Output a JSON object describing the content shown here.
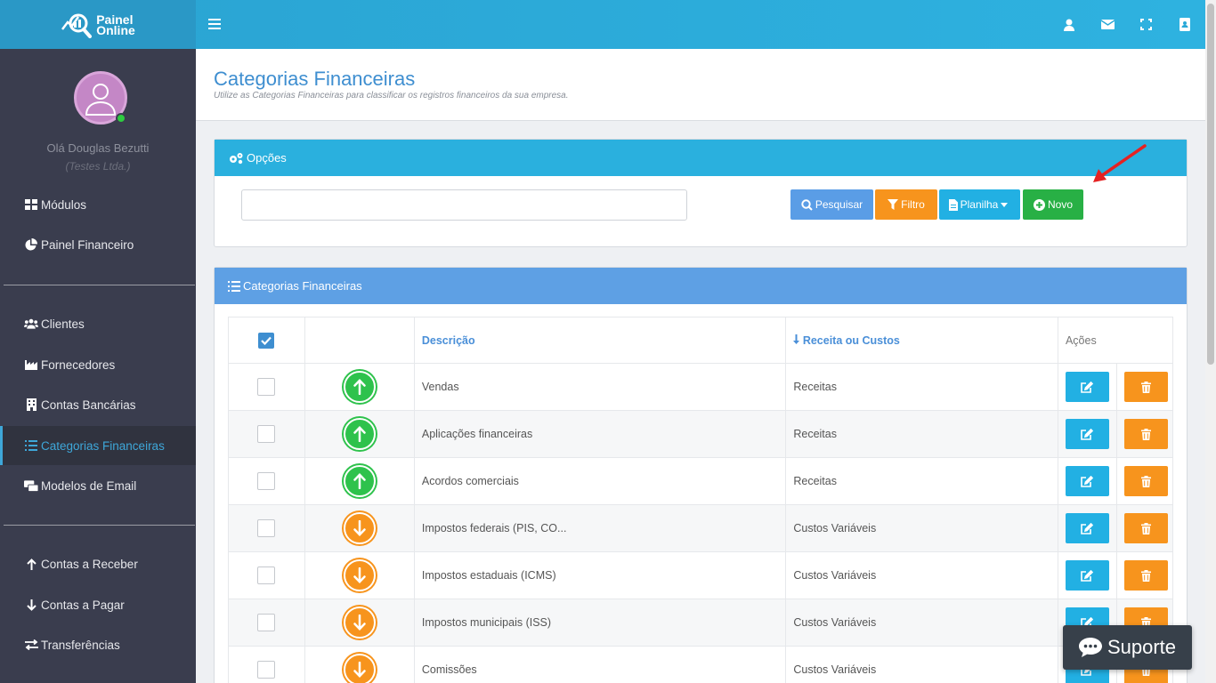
{
  "app": {
    "logo_line1": "Painel",
    "logo_line2": "Online"
  },
  "user": {
    "greeting": "Olá Douglas Bezutti",
    "company": "(Testes Ltda.)"
  },
  "sidebar": {
    "items": [
      {
        "label": "Módulos",
        "icon": "grid-icon"
      },
      {
        "label": "Painel Financeiro",
        "icon": "pie-chart-icon"
      },
      {
        "label": "Clientes",
        "icon": "users-icon"
      },
      {
        "label": "Fornecedores",
        "icon": "factory-icon"
      },
      {
        "label": "Contas Bancárias",
        "icon": "building-icon"
      },
      {
        "label": "Categorias Financeiras",
        "icon": "list-icon",
        "active": true
      },
      {
        "label": "Modelos de Email",
        "icon": "email-stack-icon"
      },
      {
        "label": "Contas a Receber",
        "icon": "arrow-up-icon"
      },
      {
        "label": "Contas a Pagar",
        "icon": "arrow-down-icon"
      },
      {
        "label": "Transferências",
        "icon": "exchange-icon"
      }
    ]
  },
  "page": {
    "title": "Categorias Financeiras",
    "subtitle": "Utilize as Categorias Financeiras para classificar os registros financeiros da sua empresa."
  },
  "options_panel": {
    "title": "Opções",
    "search_value": "",
    "search_label": "Pesquisar",
    "filter_label": "Filtro",
    "sheet_label": "Planilha",
    "new_label": "Novo"
  },
  "table_panel": {
    "title": "Categorias Financeiras",
    "columns": {
      "description": "Descrição",
      "type": "Receita ou Custos",
      "actions": "Ações"
    },
    "rows": [
      {
        "description": "Vendas",
        "type": "Receitas",
        "direction": "up"
      },
      {
        "description": "Aplicações financeiras",
        "type": "Receitas",
        "direction": "up"
      },
      {
        "description": "Acordos comerciais",
        "type": "Receitas",
        "direction": "up"
      },
      {
        "description": "Impostos federais (PIS, CO...",
        "type": "Custos Variáveis",
        "direction": "down"
      },
      {
        "description": "Impostos estaduais (ICMS)",
        "type": "Custos Variáveis",
        "direction": "down"
      },
      {
        "description": "Impostos municipais (ISS)",
        "type": "Custos Variáveis",
        "direction": "down"
      },
      {
        "description": "Comissões",
        "type": "Custos Variáveis",
        "direction": "down"
      }
    ]
  },
  "support": {
    "label": "Suporte"
  },
  "colors": {
    "primary": "#2aa9d8",
    "success": "#2ec24c",
    "warning": "#f7941d",
    "sidebar": "#3a3d4e"
  }
}
